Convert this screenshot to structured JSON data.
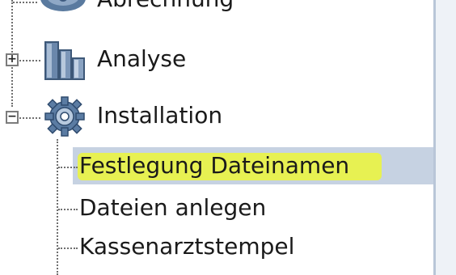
{
  "tree": {
    "nodes": [
      {
        "label": "Abrechnung",
        "icon": "gear-folder-icon",
        "expander": ""
      },
      {
        "label": "Analyse",
        "icon": "bar-chart-icon",
        "expander": "+"
      },
      {
        "label": "Installation",
        "icon": "gear-icon",
        "expander": "−"
      }
    ],
    "children": [
      {
        "label": "Festlegung Dateinamen"
      },
      {
        "label": "Dateien anlegen"
      },
      {
        "label": "Kassenarztstempel"
      }
    ]
  },
  "colors": {
    "selection": "#c6d2e2",
    "highlight": "#e9f24a",
    "panel_border": "#b9c6d8"
  }
}
